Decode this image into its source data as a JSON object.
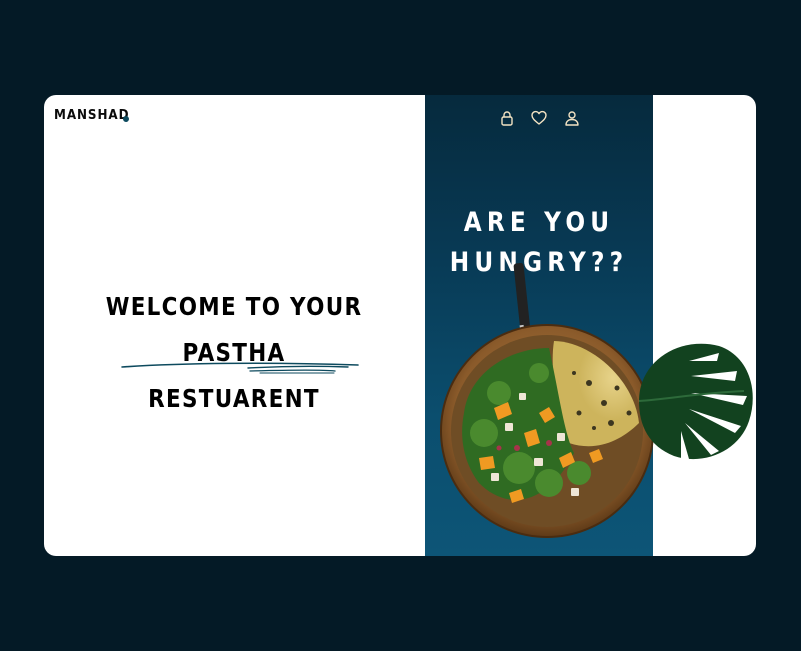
{
  "brand": {
    "name": "MANSHAD",
    "dot_color": "#0d4a5e"
  },
  "hero": {
    "welcome_line1": "WELCOME TO YOUR PASTHA",
    "welcome_line2": "RESTUARENT"
  },
  "panel": {
    "headline_line1": "ARE YOU",
    "headline_line2": "HUNGRY??"
  },
  "nav_icons": [
    "lock-icon",
    "heart-icon",
    "user-icon"
  ],
  "colors": {
    "page_bg": "#041a26",
    "panel_top": "#062a3d",
    "panel_bottom": "#0d5577",
    "accent_scribble": "#0d4a5e",
    "icon_color": "#f3e3c3"
  }
}
